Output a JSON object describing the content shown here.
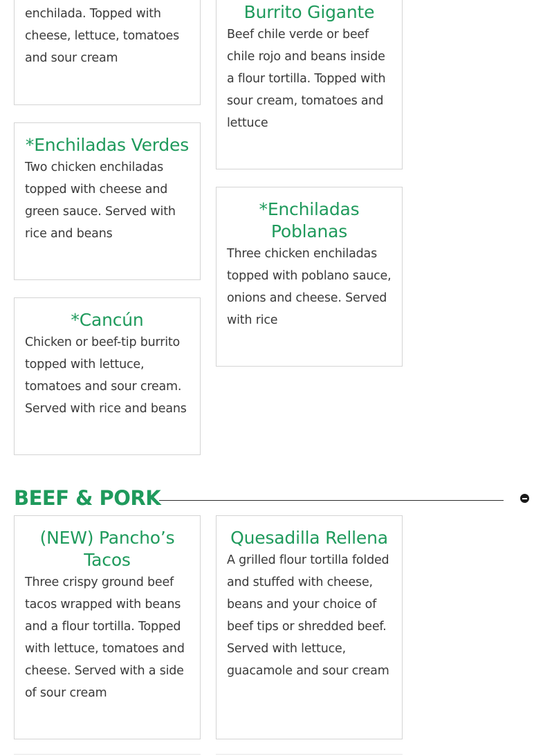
{
  "sections": {
    "beef_pork": {
      "title": "BEEF & PORK",
      "collapse_icon": "minus-circle-icon"
    }
  },
  "cards": [
    {
      "title": "",
      "desc": "enchilada. Topped with cheese, lettuce, tomatoes and sour cream"
    },
    {
      "title": "Burrito Gigante",
      "desc": "Beef chile verde or beef chile rojo and beans inside a flour tortilla. Topped with sour cream, tomatoes and lettuce"
    },
    {
      "title": "*Enchiladas Verdes",
      "desc": "Two chicken enchiladas topped with cheese and green sauce. Served with rice and beans"
    },
    {
      "title": "*Enchiladas Poblanas",
      "desc": "Three chicken enchiladas topped with poblano sauce, onions and cheese. Served with rice"
    },
    {
      "title": "*Cancún",
      "desc": "Chicken or beef-tip burrito topped with lettuce, tomatoes and sour cream. Served with rice and beans"
    },
    {
      "title": "(NEW) Pancho’s Tacos",
      "desc": "Three crispy ground beef tacos wrapped with beans and a flour tortilla. Topped with lettuce, tomatoes and cheese. Served with a side of sour cream"
    },
    {
      "title": "Quesadilla Rellena",
      "desc": "A grilled flour tortilla folded and stuffed with cheese, beans and your choice of beef tips or shredded beef. Served with lettuce, guacamole and sour cream"
    }
  ],
  "colors": {
    "accent": "#1f9a5c",
    "text": "#3a3a3a",
    "border": "#d4d4d4"
  }
}
